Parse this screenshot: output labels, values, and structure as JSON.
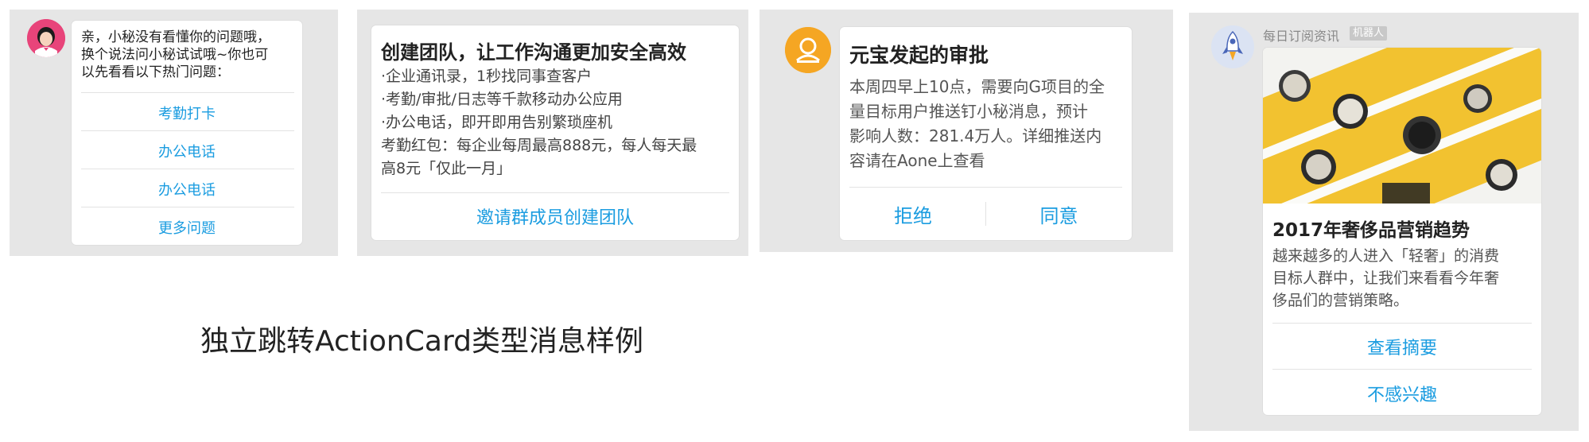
{
  "colors": {
    "link": "#1a9ce0",
    "panel_bg": "#e6e6e6",
    "card_bg": "#ffffff"
  },
  "panel1": {
    "avatar": "female-avatar-icon",
    "message_lines": [
      "亲，小秘没有看懂你的问题哦，",
      "换个说法问小秘试试哦~你也可",
      "以先看看以下热门问题："
    ],
    "links": [
      "考勤打卡",
      "办公电话",
      "办公电话",
      "更多问题"
    ]
  },
  "panel2": {
    "title": "创建团队，让工作沟通更加安全高效",
    "body": "·企业通讯录，1秒找同事查客户\n·考勤/审批/日志等千款移动办公应用\n·办公电话，即开即用告别繁琐座机\n考勤红包：每企业每周最高888元，每人每天最\n高8元「仅此一月」",
    "action": "邀请群成员创建团队"
  },
  "panel3": {
    "avatar": "user-avatar-icon",
    "title": "元宝发起的审批",
    "body": "本周四早上10点，需要向G项目的全\n量目标用户推送钉小秘消息，预计\n影响人数：281.4万人。详细推送内\n容请在Aone上查看",
    "reject": "拒绝",
    "agree": "同意"
  },
  "panel4": {
    "avatar": "rocket-avatar-icon",
    "sender": "每日订阅资讯",
    "badge": "机器人",
    "image": "watch-book-image",
    "title": "2017年奢侈品营销趋势",
    "body": "越来越多的人进入「轻奢」的消费\n目标人群中，让我们来看看今年奢\n侈品们的营销策略。",
    "actions": [
      "查看摘要",
      "不感兴趣"
    ]
  },
  "caption": "独立跳转ActionCard类型消息样例"
}
